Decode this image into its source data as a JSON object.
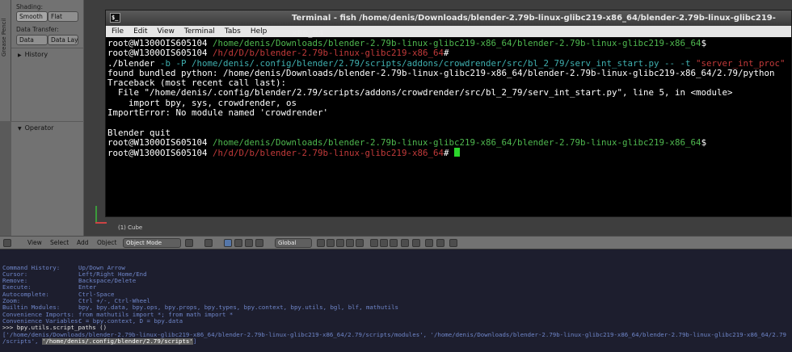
{
  "tool_shelf": {
    "grease_tab": "Grease Pencil",
    "shading_label": "Shading:",
    "shading_options": [
      "Smooth",
      "Flat"
    ],
    "data_transfer_label": "Data Transfer:",
    "data_transfer_options": [
      "Data",
      "Data Layo"
    ],
    "history_label": "History",
    "operator_label": "Operator"
  },
  "viewport": {
    "object_label": "(1) Cube"
  },
  "terminal": {
    "title": "Terminal - fish  /home/denis/Downloads/blender-2.79b-linux-glibc219-x86_64/blender-2.79b-linux-glibc219-x86_64",
    "icon_glyph": "$_",
    "menu": [
      "File",
      "Edit",
      "View",
      "Terminal",
      "Tabs",
      "Help"
    ],
    "prompt_user": "root@W1300OIS605104",
    "lines": {
      "l1_path": "/home/denis/Downloads/blender-2.79b-linux-glibc219-x86_64/blender-2.79b-linux-glibc219-x86_64",
      "l1_sym": "$",
      "l2_path": "/h/d/D/b/blender-2.79b-linux-glibc219-x86_64",
      "l2_sym": "#",
      "l3_cmd": "./blender",
      "l3_args": " -b -P /home/denis/.config/blender/2.79/scripts/addons/crowdrender/src/bl_2_79/serv_int_start.py -- -t ",
      "l3_str": "\"server_int_proc\"",
      "l4": "found bundled python: /home/denis/Downloads/blender-2.79b-linux-glibc219-x86_64/blender-2.79b-linux-glibc219-x86_64/2.79/python",
      "l5": "Traceback (most recent call last):",
      "l6": "  File \"/home/denis/.config/blender/2.79/scripts/addons/crowdrender/src/bl_2_79/serv_int_start.py\", line 5, in <module>",
      "l7": "    import bpy, sys, crowdrender, os",
      "l8": "ImportError: No module named 'crowdrender'",
      "l9": "",
      "l10": "Blender quit",
      "l11_path": "/home/denis/Downloads/blender-2.79b-linux-glibc219-x86_64/blender-2.79b-linux-glibc219-x86_64",
      "l11_sym": "$",
      "l12_path": "/h/d/D/b/blender-2.79b-linux-glibc219-x86_64",
      "l12_sym": "#"
    }
  },
  "header_bar": {
    "menus": [
      "View",
      "Select",
      "Add",
      "Object"
    ],
    "mode": "Object Mode",
    "orientation": "Global"
  },
  "console": {
    "rows": [
      {
        "key": "Command History:",
        "value": "Up/Down Arrow"
      },
      {
        "key": "Cursor:",
        "value": "Left/Right Home/End"
      },
      {
        "key": "Remove:",
        "value": "Backspace/Delete"
      },
      {
        "key": "Execute:",
        "value": "Enter"
      },
      {
        "key": "Autocomplete:",
        "value": "Ctrl-Space"
      },
      {
        "key": "Zoom:",
        "value": "Ctrl +/-, Ctrl-Wheel"
      },
      {
        "key": "Builtin Modules:",
        "value": "bpy, bpy.data, bpy.ops, bpy.props, bpy.types, bpy.context, bpy.utils, bgl, blf, mathutils"
      },
      {
        "key": "Convenience Imports:",
        "value": "from mathutils import *; from math import *"
      },
      {
        "key": "Convenience Variables:",
        "value": "C = bpy.context, D = bpy.data"
      }
    ],
    "command": ">>> bpy.utils.script_paths ()",
    "output_1": "['/home/denis/Downloads/blender-2.79b-linux-glibc219-x86_64/blender-2.79b-linux-glibc219-x86_64/2.79/scripts/modules', '/home/denis/Downloads/blender-2.79b-linux-glibc219-x86_64/blender-2.79b-linux-glibc219-x86_64/2.79",
    "output_2a": "/scripts', ",
    "output_2b": "'/home/denis/.config/blender/2.79/scripts'",
    "output_2c": "]"
  },
  "colors": {
    "terminal_bg": "#000000",
    "prompt_green": "#4fb84f",
    "path_red": "#c23a3a",
    "arg_cyan": "#3fb0b0",
    "console_bg": "#1d1e2e",
    "console_text": "#6f86c9"
  }
}
